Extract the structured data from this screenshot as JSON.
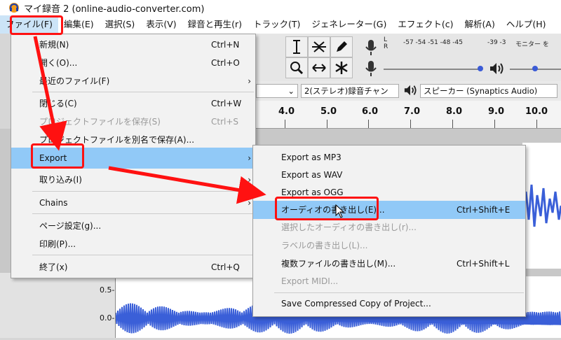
{
  "window": {
    "title": "マイ録音 2 (online-audio-converter.com)"
  },
  "menubar": {
    "items": [
      {
        "id": "file",
        "label": "ファイル(F)"
      },
      {
        "id": "edit",
        "label": "編集(E)"
      },
      {
        "id": "select",
        "label": "選択(S)"
      },
      {
        "id": "view",
        "label": "表示(V)"
      },
      {
        "id": "transport",
        "label": "録音と再生(r)"
      },
      {
        "id": "tracks",
        "label": "トラック(T)"
      },
      {
        "id": "generate",
        "label": "ジェネレーター(G)"
      },
      {
        "id": "effect",
        "label": "エフェクト(c)"
      },
      {
        "id": "analyze",
        "label": "解析(A)"
      },
      {
        "id": "help",
        "label": "ヘルプ(H)"
      }
    ]
  },
  "meter": {
    "channels": "L\nR",
    "scale": "-57 -54 -51 -48 -45",
    "scale2": "-39 -3",
    "monitor": "モニター を"
  },
  "devices": {
    "channels": "2(ステレオ)録音チャン",
    "output": "スピーカー (Synaptics Audio)"
  },
  "ruler": {
    "ticks": [
      "4.0",
      "5.0",
      "6.0",
      "7.0",
      "8.0",
      "9.0",
      "10.0"
    ]
  },
  "track": {
    "scale_top": "0.5-",
    "scale_mid": "0.0-"
  },
  "file_menu": {
    "items": [
      {
        "label": "新規(N)",
        "shortcut": "Ctrl+N"
      },
      {
        "label": "開く(O)...",
        "shortcut": "Ctrl+O"
      },
      {
        "label": "最近のファイル(F)",
        "arrow": "›"
      },
      {
        "label": "閉じる(C)",
        "shortcut": "Ctrl+W"
      },
      {
        "label": "プロジェクトファイルを保存(S)",
        "shortcut": "Ctrl+S"
      },
      {
        "label": "プロジェクトファイルを別名で保存(A)..."
      },
      {
        "label": "Export",
        "arrow": "›"
      },
      {
        "label": "取り込み(I)",
        "arrow": "›"
      },
      {
        "label": "Chains",
        "arrow": "›"
      },
      {
        "label": "ページ設定(g)..."
      },
      {
        "label": "印刷(P)..."
      },
      {
        "label": "終了(x)",
        "shortcut": "Ctrl+Q"
      }
    ]
  },
  "export_menu": {
    "items": [
      {
        "label": "Export as MP3"
      },
      {
        "label": "Export as WAV"
      },
      {
        "label": "Export as OGG"
      },
      {
        "label": "オーディオの書き出し(E)...",
        "shortcut": "Ctrl+Shift+E"
      },
      {
        "label": "選択したオーディオの書き出し(r)..."
      },
      {
        "label": "ラベルの書き出し(L)..."
      },
      {
        "label": "複数ファイルの書き出し(M)...",
        "shortcut": "Ctrl+Shift+L"
      },
      {
        "label": "Export MIDI..."
      },
      {
        "label": "Save Compressed Copy of Project..."
      }
    ]
  },
  "colors": {
    "highlight": "#91c9f7",
    "annotation": "#ff1111",
    "waveform": "#3a5fd8"
  }
}
